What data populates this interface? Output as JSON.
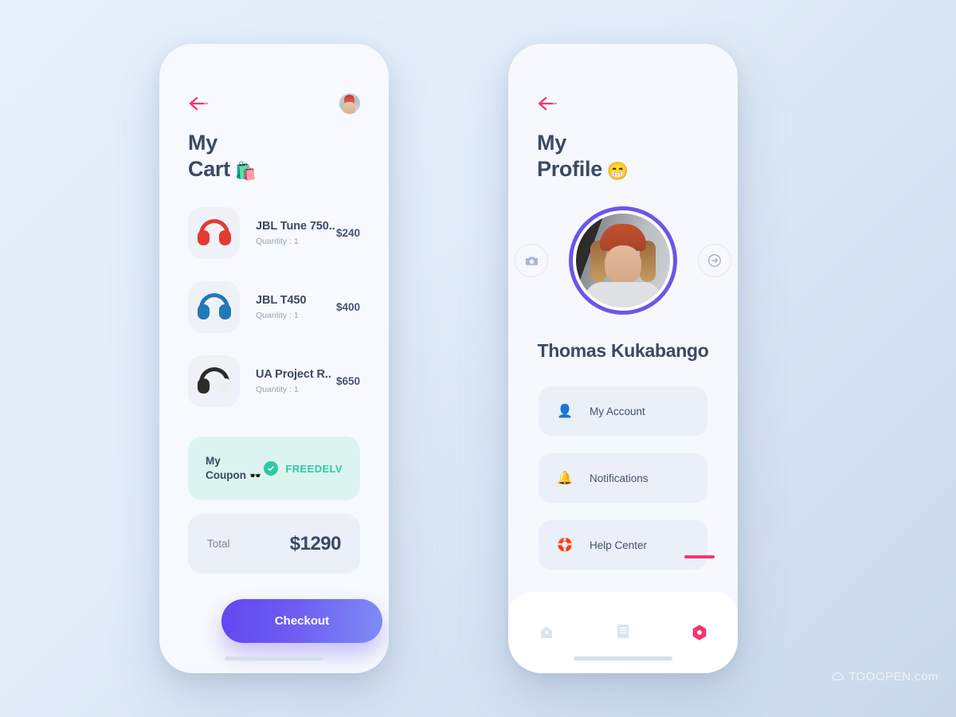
{
  "background": {
    "gradient_from": "#e6f0fb",
    "gradient_to": "#c9d8ea"
  },
  "watermark": {
    "text": "TOOOPEN.com"
  },
  "colors": {
    "heading": "#3b4a62",
    "accent_pink": "#f5356e",
    "accent_purple": "#6a57e8",
    "accent_green": "#2ec9a4",
    "card": "#eaeff8",
    "coupon_card": "#dcf4ef"
  },
  "cart_screen": {
    "back_label": "Back",
    "avatar_label": "User avatar",
    "title_line1": "My",
    "title_line2": "Cart",
    "title_emoji": "🛍️",
    "items": [
      {
        "name": "JBL Tune 750..",
        "quantity_label": "Quantity : 1",
        "price": "$240",
        "color": "red"
      },
      {
        "name": "JBL T450",
        "quantity_label": "Quantity : 1",
        "price": "$400",
        "color": "blue"
      },
      {
        "name": "UA Project R..",
        "quantity_label": "Quantity : 1",
        "price": "$650",
        "color": "black"
      }
    ],
    "coupon": {
      "label_line1": "My",
      "label_line2": "Coupon",
      "label_emoji": "🕶️",
      "code": "FREEDELV",
      "applied": true
    },
    "total": {
      "label": "Total",
      "value": "$1290"
    },
    "checkout_label": "Checkout"
  },
  "profile_screen": {
    "back_label": "Back",
    "title_line1": "My",
    "title_line2": "Profile",
    "title_emoji": "😁",
    "camera_button_label": "Change photo",
    "logout_button_label": "Log out",
    "name": "Thomas Kukabango",
    "menu": [
      {
        "label": "My Account",
        "icon": "👤"
      },
      {
        "label": "Notifications",
        "icon": "🔔"
      },
      {
        "label": "Help Center",
        "icon": "🛟"
      }
    ],
    "tabs": [
      {
        "name": "home",
        "active": false
      },
      {
        "name": "orders",
        "active": false
      },
      {
        "name": "profile",
        "active": true
      }
    ]
  }
}
